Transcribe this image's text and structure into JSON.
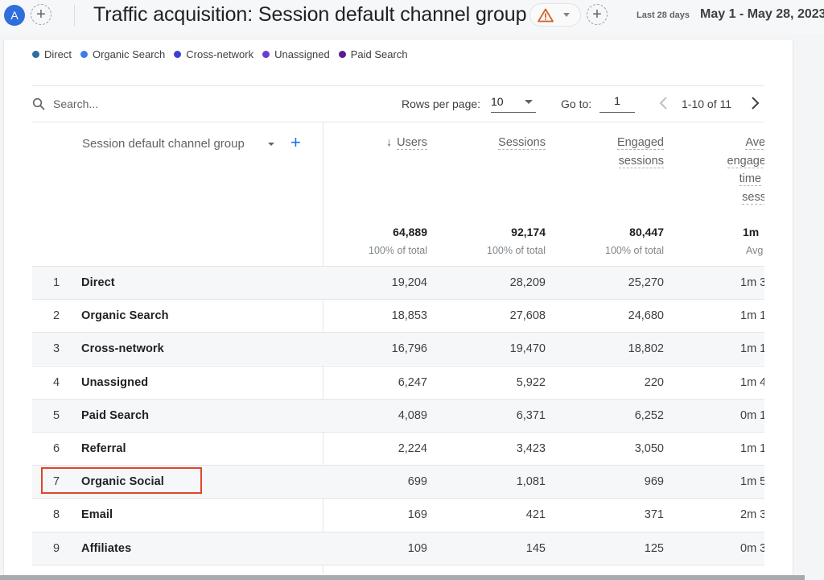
{
  "header": {
    "avatar_letter": "A",
    "title": "Traffic acquisition: Session default channel group",
    "date_label": "Last 28 days",
    "date_range": "May 1 - May 28, 2023"
  },
  "legend": [
    {
      "label": "Direct",
      "color": "#2e6da4"
    },
    {
      "label": "Organic Search",
      "color": "#3d7de0"
    },
    {
      "label": "Cross-network",
      "color": "#3d3ed8"
    },
    {
      "label": "Unassigned",
      "color": "#6c3bd0"
    },
    {
      "label": "Paid Search",
      "color": "#5b1a8e"
    }
  ],
  "toolbar": {
    "search_placeholder": "Search...",
    "rows_per_page_label": "Rows per page:",
    "rows_per_page_value": "10",
    "goto_label": "Go to:",
    "goto_value": "1",
    "page_info": "1-10 of 11"
  },
  "table": {
    "dimension_header": "Session default channel group",
    "columns": {
      "users": "Users",
      "sessions": "Sessions",
      "engaged_line1": "Engaged",
      "engaged_line2": "sessions",
      "avg_line1": "Avera",
      "avg_line2": "engagem",
      "avg_line3": "time",
      "avg_line4": "sess"
    },
    "totals": {
      "users": "64,889",
      "users_sub": "100% of total",
      "sessions": "92,174",
      "sessions_sub": "100% of total",
      "engaged": "80,447",
      "engaged_sub": "100% of total",
      "avg": "1m",
      "avg_sub": "Avg"
    },
    "rows": [
      {
        "idx": "1",
        "name": "Direct",
        "users": "19,204",
        "sessions": "28,209",
        "engaged": "25,270",
        "avg": "1m 3"
      },
      {
        "idx": "2",
        "name": "Organic Search",
        "users": "18,853",
        "sessions": "27,608",
        "engaged": "24,680",
        "avg": "1m 1"
      },
      {
        "idx": "3",
        "name": "Cross-network",
        "users": "16,796",
        "sessions": "19,470",
        "engaged": "18,802",
        "avg": "1m 1"
      },
      {
        "idx": "4",
        "name": "Unassigned",
        "users": "6,247",
        "sessions": "5,922",
        "engaged": "220",
        "avg": "1m 4"
      },
      {
        "idx": "5",
        "name": "Paid Search",
        "users": "4,089",
        "sessions": "6,371",
        "engaged": "6,252",
        "avg": "0m 1"
      },
      {
        "idx": "6",
        "name": "Referral",
        "users": "2,224",
        "sessions": "3,423",
        "engaged": "3,050",
        "avg": "1m 1"
      },
      {
        "idx": "7",
        "name": "Organic Social",
        "users": "699",
        "sessions": "1,081",
        "engaged": "969",
        "avg": "1m 5"
      },
      {
        "idx": "8",
        "name": "Email",
        "users": "169",
        "sessions": "421",
        "engaged": "371",
        "avg": "2m 3"
      },
      {
        "idx": "9",
        "name": "Affiliates",
        "users": "109",
        "sessions": "145",
        "engaged": "125",
        "avg": "0m 3"
      }
    ],
    "highlighted_row": "7"
  },
  "colors": {
    "accent": "#1a73e8",
    "warning": "#d2632a",
    "highlight_border": "#e0452c"
  }
}
